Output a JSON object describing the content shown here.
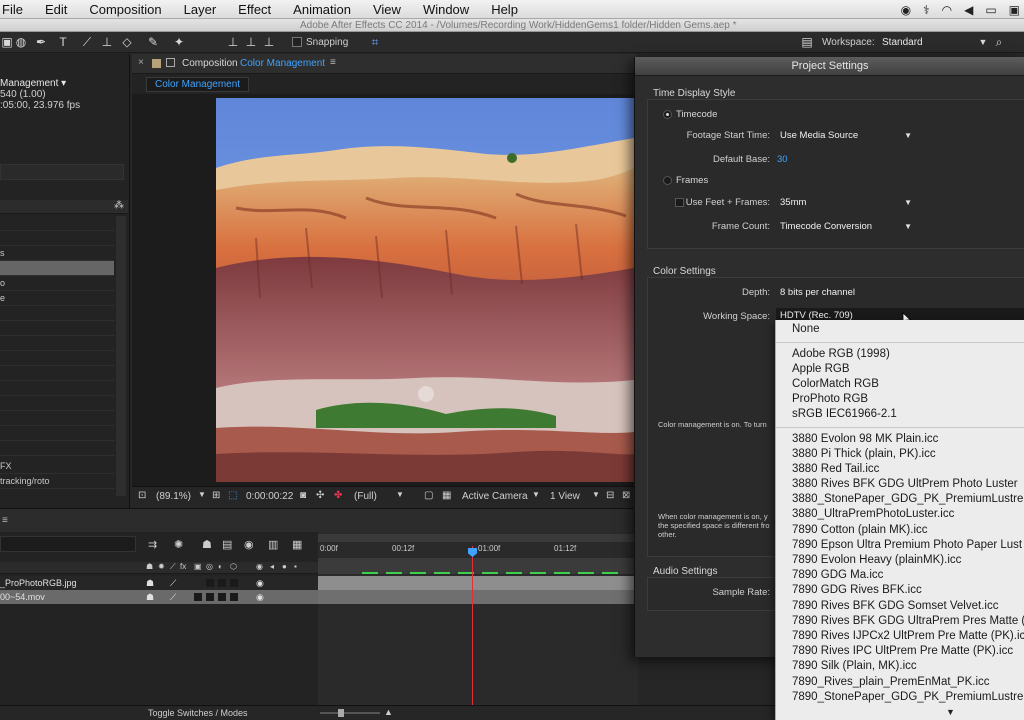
{
  "menubar": {
    "items": [
      "File",
      "Edit",
      "Composition",
      "Layer",
      "Effect",
      "Animation",
      "View",
      "Window",
      "Help"
    ]
  },
  "titlebar": {
    "text": "Adobe After Effects CC 2014 - /Volumes/Recording Work/HiddenGems1 folder/Hidden Gems.aep *"
  },
  "toolbar": {
    "snapping_label": "Snapping",
    "workspace_label": "Workspace:",
    "workspace_value": "Standard"
  },
  "project_panel": {
    "comp_name": "Management ▾",
    "info_line1": "540 (1.00)",
    "info_line2": ":05:00, 23.976 fps",
    "row_labels": [
      "s",
      "",
      "o",
      "e",
      "FX",
      "tracking/roto"
    ]
  },
  "composition": {
    "header_prefix": "Composition",
    "header_name": "Color Management",
    "tab_label": "Color Management",
    "zoom": "(89.1%)",
    "timecode": "0:00:00:22",
    "resolution": "(Full)",
    "camera": "Active Camera",
    "views": "1 View"
  },
  "timeline": {
    "ruler": [
      "0:00f",
      "00:12f",
      "01:00f",
      "01:12f"
    ],
    "layers": [
      "_ProPhotoRGB.jpg",
      "00~54.mov"
    ],
    "footer_label": "Toggle Switches / Modes"
  },
  "dialog": {
    "title": "Project Settings",
    "time_display": {
      "section_title": "Time Display Style",
      "timecode_label": "Timecode",
      "footage_start_label": "Footage Start Time:",
      "footage_start_value": "Use Media Source",
      "default_base_label": "Default Base:",
      "default_base_value": "30",
      "frames_label": "Frames",
      "use_feet_label": "Use Feet + Frames:",
      "use_feet_value": "35mm",
      "frame_count_label": "Frame Count:",
      "frame_count_value": "Timecode Conversion"
    },
    "color_settings": {
      "section_title": "Color Settings",
      "depth_label": "Depth:",
      "depth_value": "8 bits per channel",
      "working_space_label": "Working Space:",
      "working_space_value": "HDTV (Rec. 709)",
      "note1": "Color management is on. To turn",
      "note2_line1": "When color management is on, y",
      "note2_line2": "the specified space is different fro",
      "note2_line3": "other."
    },
    "audio_settings": {
      "section_title": "Audio Settings",
      "sample_rate_label": "Sample Rate:"
    }
  },
  "working_space_dropdown": {
    "group1": [
      "None"
    ],
    "group2": [
      "Adobe RGB (1998)",
      "Apple RGB",
      "ColorMatch RGB",
      "ProPhoto RGB",
      "sRGB IEC61966-2.1"
    ],
    "group3": [
      "3880 Evolon 98 MK Plain.icc",
      "3880 Pi Thick (plain, PK).icc",
      "3880 Red Tail.icc",
      "3880 Rives BFK GDG UltPrem Photo Luster",
      "3880_StonePaper_GDG_PK_PremiumLustre.",
      "3880_UltraPremPhotoLuster.icc",
      "7890 Cotton (plain MK).icc",
      "7890 Epson Ultra Premium Photo Paper Lust",
      "7890 Evolon Heavy (plainMK).icc",
      "7890 GDG Ma.icc",
      "7890 GDG Rives BFK.icc",
      "7890 Rives BFK GDG Somset Velvet.icc",
      "7890 Rives BFK GDG UltraPrem Pres Matte (",
      "7890 Rives IJPCx2 UltPrem Pre Matte (PK).ic",
      "7890 Rives IPC UltPrem Pre Matte (PK).icc",
      "7890 Silk (Plain, MK).icc",
      "7890_Rives_plain_PremEnMat_PK.icc",
      "7890_StonePaper_GDG_PK_PremiumLustre."
    ]
  }
}
